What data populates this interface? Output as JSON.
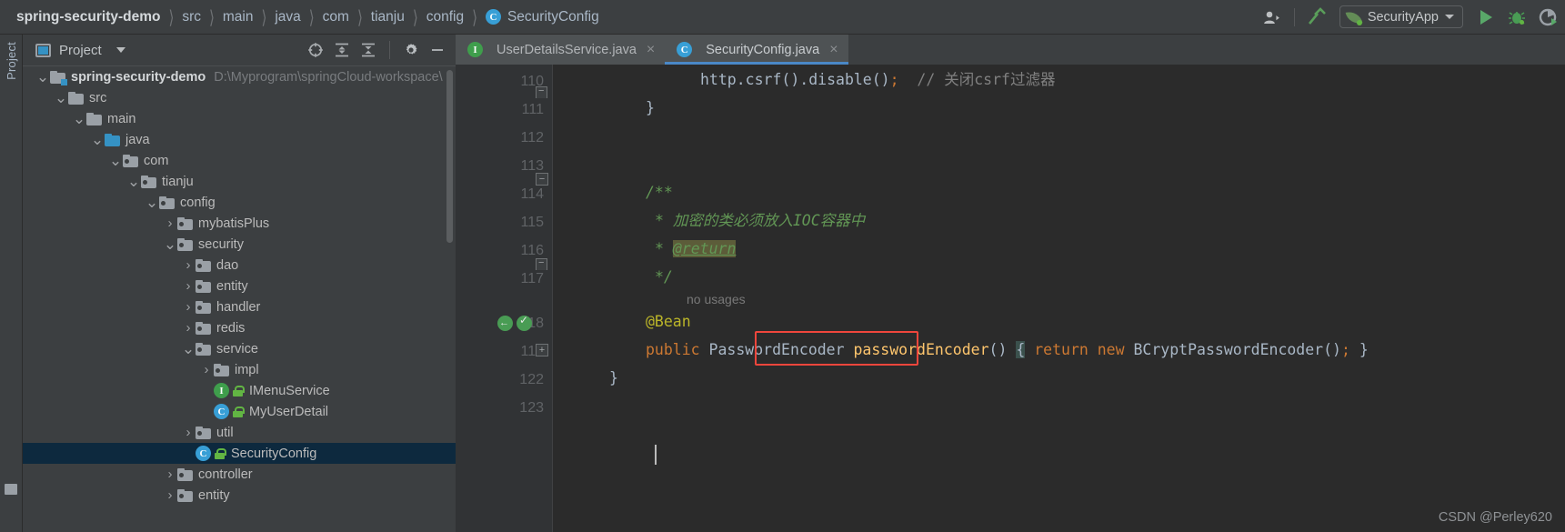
{
  "window": {
    "app": "IntelliJ IDEA",
    "file": "SecurityConfig.java"
  },
  "breadcrumb": {
    "separator": "〉",
    "items": [
      {
        "label": "spring-security-demo",
        "icon": "",
        "root": true
      },
      {
        "label": "src",
        "icon": ""
      },
      {
        "label": "main",
        "icon": ""
      },
      {
        "label": "java",
        "icon": ""
      },
      {
        "label": "com",
        "icon": ""
      },
      {
        "label": "tianju",
        "icon": ""
      },
      {
        "label": "config",
        "icon": ""
      },
      {
        "label": "SecurityConfig",
        "icon": "class-badge-c",
        "badge": "C"
      }
    ]
  },
  "toolbar": {
    "user_icon": "user-account-icon",
    "build_icon": "build-hammer-icon",
    "run_config": {
      "name": "SecurityApp",
      "icon": "spring-boot-icon",
      "caret": "▾"
    },
    "run_icon": "run-play-icon",
    "debug_icon": "debug-bug-icon",
    "coverage_icon": "run-with-coverage-icon"
  },
  "left_strip": {
    "label": "Project",
    "bottom_icon": "structure-icon"
  },
  "project_panel": {
    "title": "Project",
    "icon": "project-view-icon",
    "caret": "▾",
    "actions": [
      {
        "name": "select-opened-file-icon",
        "glyph": "⊕"
      },
      {
        "name": "expand-all-icon",
        "glyph": "☰"
      },
      {
        "name": "collapse-all-icon",
        "glyph": "☷"
      },
      {
        "name": "settings-gear-icon",
        "glyph": "⚙"
      },
      {
        "name": "hide-panel-icon",
        "glyph": "—"
      }
    ],
    "tree": [
      {
        "depth": 0,
        "arrow": "down",
        "icon": "module-folder",
        "label": "spring-security-demo",
        "bold": true,
        "path": "D:\\Myprogram\\springCloud-workspace\\"
      },
      {
        "depth": 1,
        "arrow": "down",
        "icon": "folder",
        "label": "src"
      },
      {
        "depth": 2,
        "arrow": "down",
        "icon": "folder",
        "label": "main"
      },
      {
        "depth": 3,
        "arrow": "down",
        "icon": "source-folder",
        "label": "java"
      },
      {
        "depth": 4,
        "arrow": "down",
        "icon": "package",
        "label": "com"
      },
      {
        "depth": 5,
        "arrow": "down",
        "icon": "package",
        "label": "tianju"
      },
      {
        "depth": 6,
        "arrow": "down",
        "icon": "package",
        "label": "config"
      },
      {
        "depth": 7,
        "arrow": "right",
        "icon": "package",
        "label": "mybatisPlus"
      },
      {
        "depth": 7,
        "arrow": "down",
        "icon": "package",
        "label": "security"
      },
      {
        "depth": 8,
        "arrow": "right",
        "icon": "package",
        "label": "dao"
      },
      {
        "depth": 8,
        "arrow": "right",
        "icon": "package",
        "label": "entity"
      },
      {
        "depth": 8,
        "arrow": "right",
        "icon": "package",
        "label": "handler"
      },
      {
        "depth": 8,
        "arrow": "right",
        "icon": "package",
        "label": "redis"
      },
      {
        "depth": 8,
        "arrow": "down",
        "icon": "package",
        "label": "service"
      },
      {
        "depth": 9,
        "arrow": "right",
        "icon": "package",
        "label": "impl"
      },
      {
        "depth": 9,
        "arrow": "none",
        "icon": "interface",
        "label": "IMenuService",
        "lock": true
      },
      {
        "depth": 9,
        "arrow": "none",
        "icon": "class",
        "label": "MyUserDetail",
        "lock": true
      },
      {
        "depth": 8,
        "arrow": "right",
        "icon": "package",
        "label": "util"
      },
      {
        "depth": 8,
        "arrow": "none",
        "icon": "class",
        "label": "SecurityConfig",
        "lock": true,
        "selected": true
      },
      {
        "depth": 7,
        "arrow": "right",
        "icon": "package",
        "label": "controller"
      },
      {
        "depth": 7,
        "arrow": "right",
        "icon": "package",
        "label": "entity"
      }
    ]
  },
  "editor": {
    "tabs": [
      {
        "label": "UserDetailsService.java",
        "icon": "interface-badge-i",
        "badge": "I",
        "active": false,
        "close": "×"
      },
      {
        "label": "SecurityConfig.java",
        "icon": "class-badge-c",
        "badge": "C",
        "active": true,
        "close": "×"
      }
    ],
    "line_numbers": [
      "110",
      "111",
      "112",
      "113",
      "114",
      "115",
      "116",
      "117",
      "118",
      "119",
      "122",
      "123"
    ],
    "inlay_hint": "no usages",
    "gutter_icons": [
      {
        "line": "118",
        "name": "implemented-method-icon"
      },
      {
        "line": "118",
        "name": "bean-candidate-icon"
      }
    ],
    "code_lines": [
      {
        "line": "110",
        "indent": 14,
        "tokens": [
          {
            "t": "http.csrf().disable()",
            "c": "type"
          },
          {
            "t": ";",
            "c": "semi"
          },
          {
            "t": "  // 关闭csrf过滤器",
            "c": "cmt"
          }
        ]
      },
      {
        "line": "111",
        "indent": 8,
        "tokens": [
          {
            "t": "}",
            "c": "punc"
          }
        ]
      },
      {
        "line": "112",
        "indent": 0,
        "tokens": []
      },
      {
        "line": "113",
        "indent": 0,
        "tokens": []
      },
      {
        "line": "114",
        "indent": 8,
        "tokens": [
          {
            "t": "/**",
            "c": "jdoc"
          }
        ]
      },
      {
        "line": "115",
        "indent": 9,
        "tokens": [
          {
            "t": "* 加密的类必须放入IOC容器中",
            "c": "jdoc"
          }
        ]
      },
      {
        "line": "116",
        "indent": 9,
        "tokens": [
          {
            "t": "* ",
            "c": "jdoc"
          },
          {
            "t": "@return",
            "c": "jtag"
          }
        ]
      },
      {
        "line": "117",
        "indent": 9,
        "tokens": [
          {
            "t": "*/",
            "c": "jdoc"
          }
        ]
      },
      {
        "line": "118",
        "indent": 8,
        "tokens": [
          {
            "t": "@Bean",
            "c": "anno"
          }
        ]
      },
      {
        "line": "119",
        "indent": 8,
        "tokens": [
          {
            "t": "public",
            "c": "kw"
          },
          {
            "t": " PasswordEncoder ",
            "c": "type"
          },
          {
            "t": "passwordEncoder",
            "c": "meth"
          },
          {
            "t": "()",
            "c": "punc"
          },
          {
            "t": " ",
            "c": "punc"
          },
          {
            "t": "{",
            "c": "brace-hl"
          },
          {
            "t": " ",
            "c": "punc"
          },
          {
            "t": "return",
            "c": "kw"
          },
          {
            "t": " ",
            "c": "punc"
          },
          {
            "t": "new",
            "c": "kw"
          },
          {
            "t": " BCryptPasswordEncoder()",
            "c": "type"
          },
          {
            "t": ";",
            "c": "semi"
          },
          {
            "t": " }",
            "c": "punc"
          }
        ]
      },
      {
        "line": "122",
        "indent": 4,
        "tokens": [
          {
            "t": "}",
            "c": "punc"
          }
        ]
      },
      {
        "line": "123",
        "indent": 0,
        "tokens": []
      }
    ],
    "annotation": {
      "name": "red-highlight-box",
      "target": "PasswordEncoder",
      "color": "#f0463c"
    }
  },
  "watermark": "CSDN @Perley620",
  "colors": {
    "background": "#3c3f41",
    "editor_background": "#2b2b2b",
    "gutter": "#313335",
    "selection": "#0d293e",
    "tab_accent": "#4a88c7",
    "keyword": "#cc7832",
    "annotation": "#bbb529",
    "javadoc": "#629755",
    "method": "#ffc66d",
    "comment": "#808080",
    "highlight_box": "#f0463c"
  }
}
